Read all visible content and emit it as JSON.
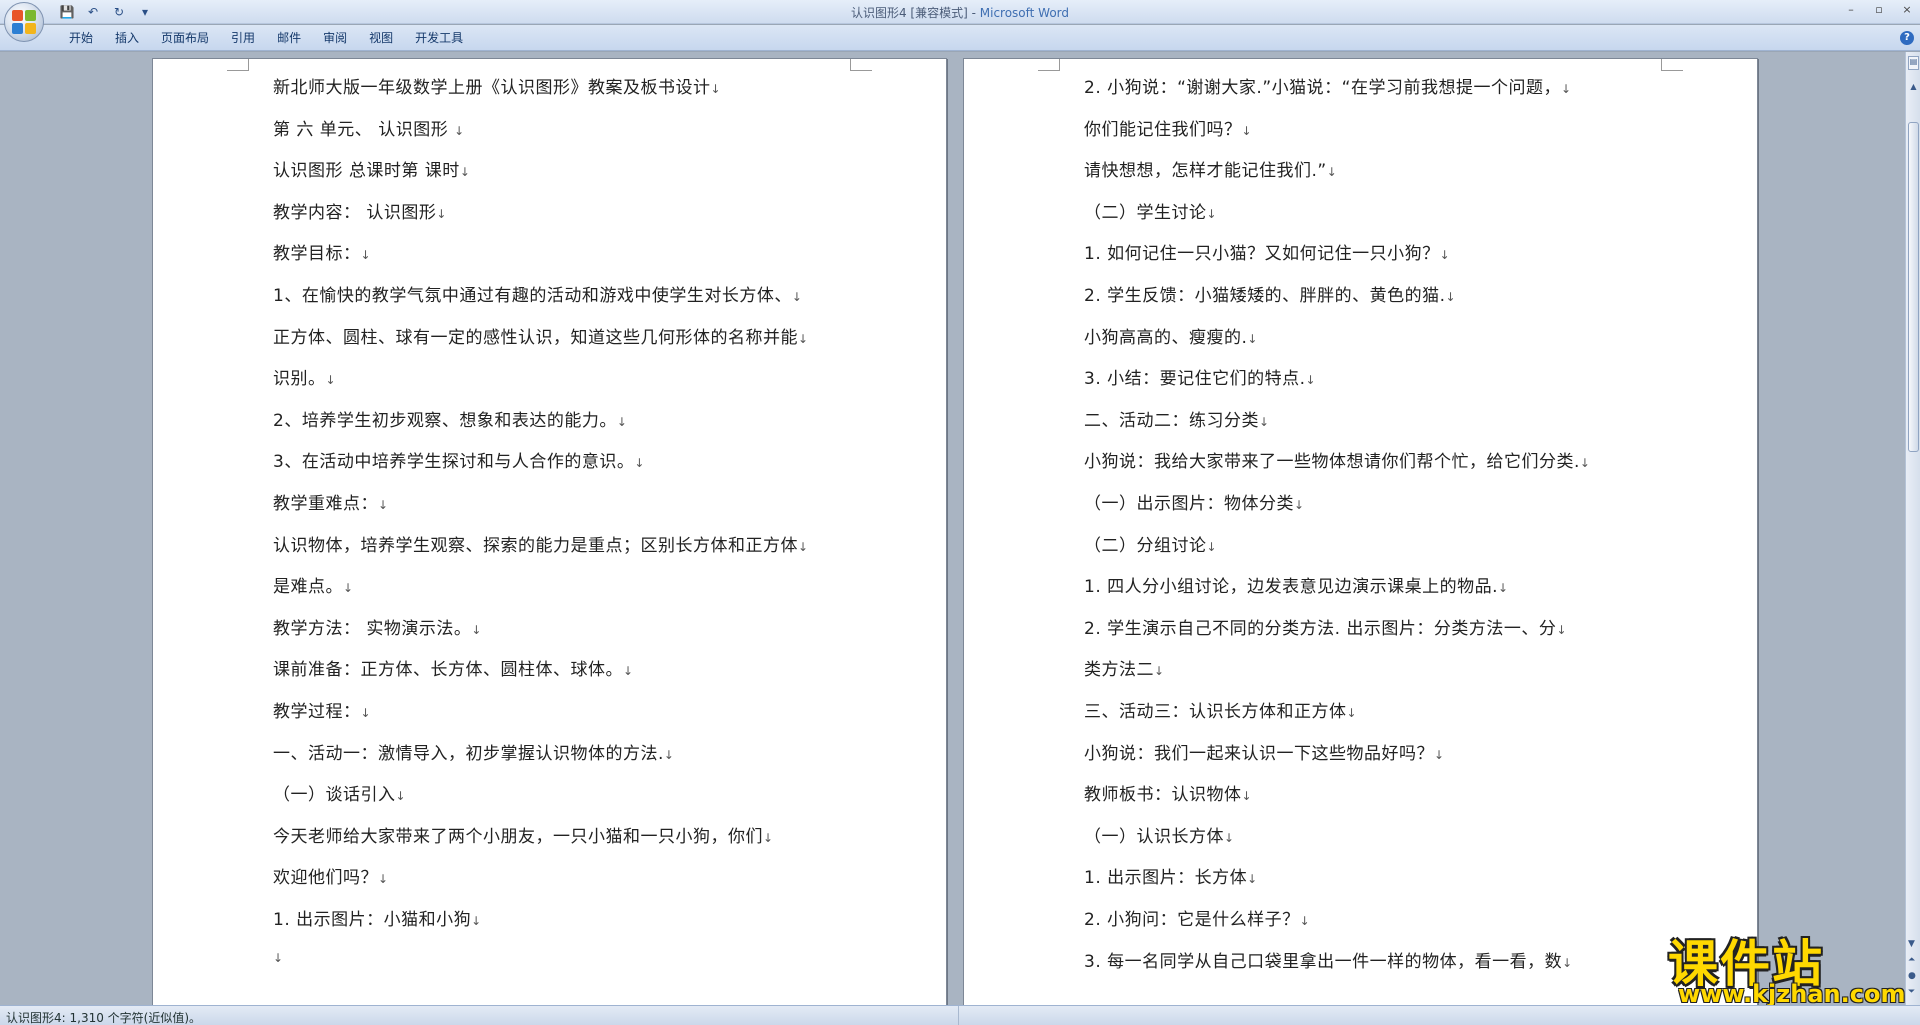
{
  "window": {
    "title": "认识图形4 [兼容模式]",
    "title_sep": " - ",
    "app_name": "Microsoft Word",
    "minimize": "–",
    "maximize": "▫",
    "close": "×"
  },
  "qat": {
    "save": "💾",
    "undo": "↶",
    "redo": "↻",
    "more": "▾"
  },
  "ribbon": {
    "tabs": [
      "开始",
      "插入",
      "页面布局",
      "引用",
      "邮件",
      "审阅",
      "视图",
      "开发工具"
    ],
    "help": "?"
  },
  "pages": {
    "left": [
      "新北师大版一年级数学上册《认识图形》教案及板书设计",
      "第 六 单元、   认识图形  ",
      "认识图形           总课时第          课时",
      "教学内容：   认识图形",
      "教学目标：",
      "1、在愉快的教学气氛中通过有趣的活动和游戏中使学生对长方体、",
      "正方体、圆柱、球有一定的感性认识，知道这些几何形体的名称并能",
      "识别。",
      "2、培养学生初步观察、想象和表达的能力。",
      "3、在活动中培养学生探讨和与人合作的意识。",
      "教学重难点：",
      "认识物体，培养学生观察、探索的能力是重点；区别长方体和正方体",
      "是难点。",
      "教学方法：  实物演示法。",
      "课前准备：正方体、长方体、圆柱体、球体。",
      "教学过程：",
      "    一、活动一：激情导入，初步掌握认识物体的方法.",
      "     （一）谈话引入",
      "     今天老师给大家带来了两个小朋友，一只小猫和一只小狗，你们",
      "欢迎他们吗？",
      "    1. 出示图片：小猫和小狗",
      "       "
    ],
    "right": [
      "    2. 小狗说：“谢谢大家.”小猫说：“在学习前我想提一个问题，",
      "你们能记住我们吗？",
      "    请快想想，怎样才能记住我们.”",
      "    （二）学生讨论",
      "    1. 如何记住一只小猫？又如何记住一只小狗？",
      "    2. 学生反馈：小猫矮矮的、胖胖的、黄色的猫.",
      "    小狗高高的、瘦瘦的.",
      "    3. 小结：要记住它们的特点.",
      "    二、活动二：练习分类",
      "    小狗说：我给大家带来了一些物体想请你们帮个忙，给它们分类.",
      "    （一）出示图片：物体分类",
      "    （二）分组讨论",
      "    1. 四人分小组讨论，边发表意见边演示课桌上的物品.",
      "    2. 学生演示自己不同的分类方法. 出示图片：分类方法一、分",
      "类方法二",
      "    三、活动三：认识长方体和正方体",
      "    小狗说：我们一起来认识一下这些物品好吗？",
      "    教师板书：认识物体",
      "    （一）认识长方体",
      "    1. 出示图片：长方体",
      "    2. 小狗问：它是什么样子？",
      "    3. 每一名同学从自己口袋里拿出一件一样的物体，看一看，数"
    ]
  },
  "paragraph_mark": "↓",
  "status": {
    "text": "认识图形4: 1,310 个字符(近似值)。"
  },
  "watermark": {
    "cn": "课件站",
    "url": "www.kjzhan.com"
  },
  "colors": {
    "accent": "#3f6fb2",
    "watermark": "#ffd800"
  }
}
